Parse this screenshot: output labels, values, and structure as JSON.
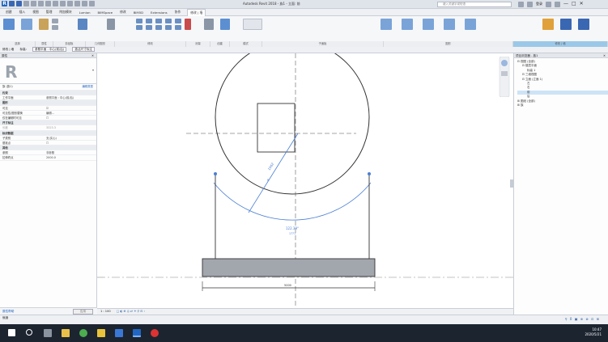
{
  "title_bar": {
    "title": "Autodesk Revit 2018 -  族1 - 立面: 前",
    "search_placeholder": "键入关键字或短语",
    "right_user": "登录",
    "controls": [
      "—",
      "□",
      "✕"
    ]
  },
  "tabs": [
    "创建",
    "插入",
    "视图",
    "管理",
    "附加模块",
    "Lumion",
    "BIMSpace",
    "修改",
    "BIM5D",
    "Extensions",
    "协作",
    "修改 | 墙"
  ],
  "active_tab_index": 11,
  "ribbon": {
    "panels": [
      "选择",
      "属性",
      "剪贴板",
      "几何图形",
      "修改",
      "测量",
      "创建",
      "模式",
      "子面板",
      "图形",
      "修改 | 墙"
    ],
    "buttons": [
      "修改",
      "粘贴",
      "剪切",
      "连接",
      "对齐",
      "移动",
      "复制",
      "旋转",
      "镜像",
      "阵列",
      "缩放",
      "拆分",
      "修剪",
      "偏移",
      "删除",
      "测量",
      "编辑轮廓",
      "附着 顶部/底部",
      "分离 顶部/底部",
      "重设轮廓"
    ]
  },
  "options_bar": {
    "label": "修改 | 墙",
    "field1_label": "标高:",
    "field1_value": "参照平面 : 中心(前/后)",
    "field2_label": "激活尺寸标注"
  },
  "properties": {
    "header": "属性",
    "type_name": "族 (族1)",
    "type_count": "编辑类型",
    "rows": [
      {
        "k": "约束",
        "v": "",
        "group": true
      },
      {
        "k": "工作平面",
        "v": "参照平面 : 中心(前/后)"
      },
      {
        "k": "图形",
        "v": "",
        "group": true
      },
      {
        "k": "可见",
        "v": "☑"
      },
      {
        "k": "可见性/图形替换",
        "v": "编辑..."
      },
      {
        "k": "仅在编辑时可见",
        "v": "☐"
      },
      {
        "k": "尺寸标注",
        "v": "",
        "group": true
      },
      {
        "k": "长度",
        "v": "3323.3",
        "grey": true
      },
      {
        "k": "标识数据",
        "v": "",
        "group": true
      },
      {
        "k": "子类别",
        "v": "无(实心)"
      },
      {
        "k": "基准点",
        "v": "☐"
      },
      {
        "k": "其他",
        "v": "",
        "group": true
      },
      {
        "k": "参照",
        "v": "非参照"
      },
      {
        "k": "拉伸终点",
        "v": "2000.0"
      }
    ],
    "help_link": "属性帮助",
    "apply": "应用"
  },
  "canvas": {
    "diameter_label": "1062",
    "radius_label": "R",
    "arc_label": "122.39°",
    "arc_sub": "1771",
    "bottom_dim": "5000"
  },
  "view_control": {
    "scale": "1 : 100",
    "icons": "□ ◐ ⊕ ◎ ⇄ ☀ ⚲ ⊟ ‹"
  },
  "project_browser": {
    "header": "项目浏览器 - 族1",
    "items": [
      {
        "t": "⊟ 视图 (全部)",
        "indent": 0
      },
      {
        "t": "⊟ 楼层平面",
        "indent": 1
      },
      {
        "t": "标高 1",
        "indent": 2
      },
      {
        "t": "⊟ 三维视图",
        "indent": 1
      },
      {
        "t": "⊟ 立面 (立面 1)",
        "indent": 1
      },
      {
        "t": "左",
        "indent": 2
      },
      {
        "t": "右",
        "indent": 2
      },
      {
        "t": "前",
        "indent": 2,
        "sel": true
      },
      {
        "t": "后",
        "indent": 2
      },
      {
        "t": "⊞ 图纸 (全部)",
        "indent": 0
      },
      {
        "t": "⊞ 族",
        "indent": 0
      }
    ]
  },
  "status": {
    "left": "就绪",
    "icons": "⚲ 0  ▣ ⊕ ⊗ ⊡ ⊞"
  },
  "taskbar": {
    "time": "10:47",
    "date": "2020/5/21"
  },
  "colors": {
    "accent": "#2166c2",
    "selection": "#4a7fd4",
    "taskbar": "#1c2430"
  }
}
